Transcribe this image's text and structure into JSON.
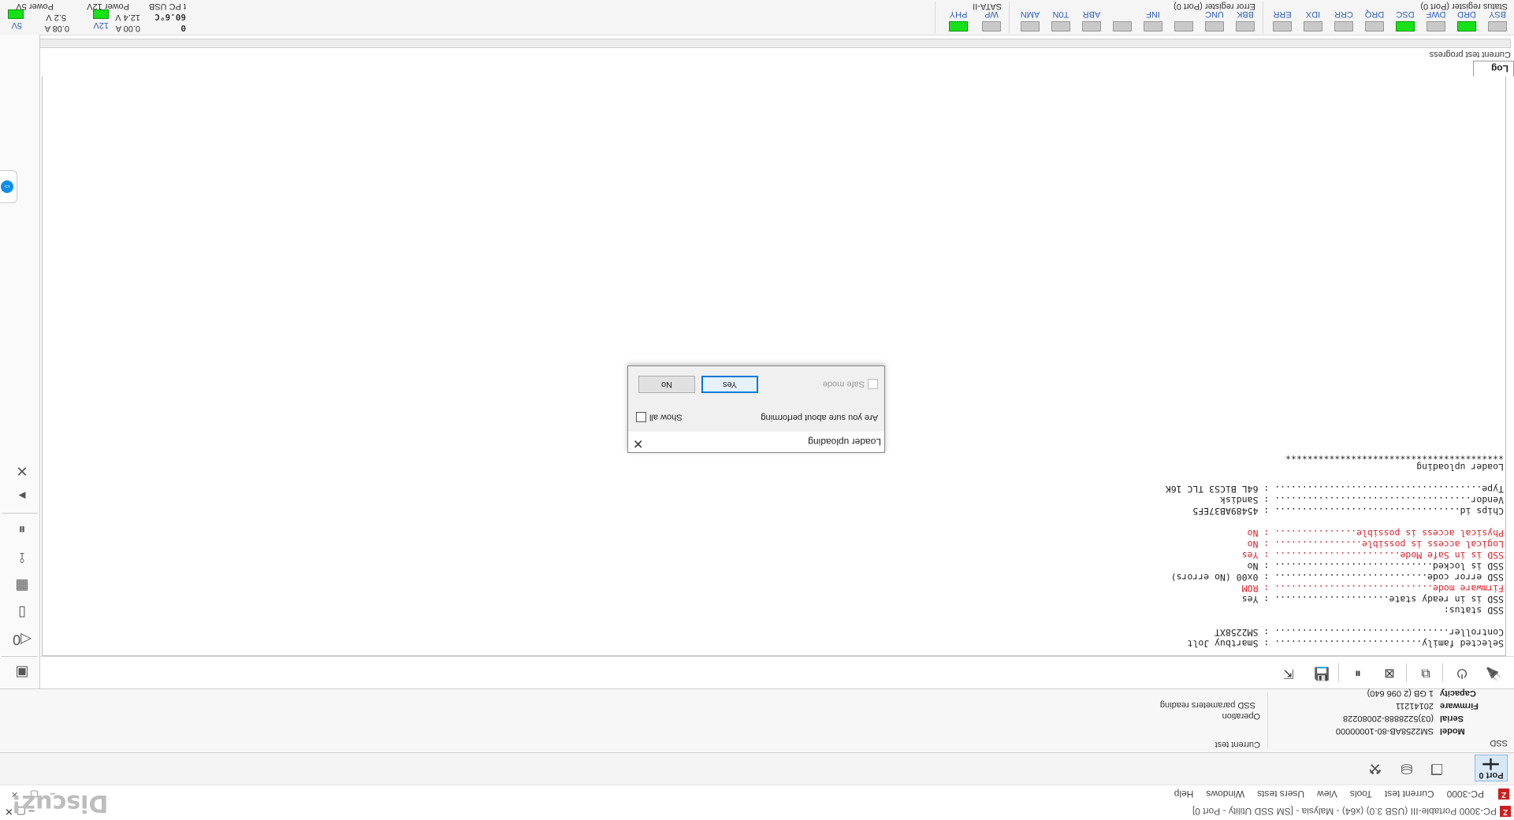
{
  "window": {
    "title": "PC-3000 Portable-III (USB 3.0) (x64) - Malysia - [SM SSD Utility - Port 0]",
    "controls": "–  ▢  ✕",
    "mdi_controls": "– ▢ ✕"
  },
  "menu": {
    "items": [
      "PC-3000",
      "Current test",
      "Tools",
      "View",
      "Users tests",
      "Windows",
      "Help"
    ]
  },
  "watermark": "Discuz!",
  "toolbar2": {
    "port_label": "Port 0"
  },
  "ssd": {
    "caption": "SSD",
    "rows": [
      {
        "key": "Model",
        "value": "SM2258AB-80-10000000"
      },
      {
        "key": "Serial",
        "value": "(03)5228888-20080228"
      },
      {
        "key": "Firmware",
        "value": "20141211"
      },
      {
        "key": "Capacity",
        "value": "1 GB (2 096 640)"
      }
    ]
  },
  "test": {
    "current_test_caption": "Current test",
    "operation_caption": "Operation",
    "operation_value": "SSD parameters reading"
  },
  "log": {
    "tab": "Log",
    "lines": [
      {
        "text": "Selected family........................... : Smartbuy Jolt",
        "red": false
      },
      {
        "text": "Controller................................ : SM2258XT",
        "red": false
      },
      {
        "text": "",
        "red": false
      },
      {
        "text": "SSD status:",
        "red": false
      },
      {
        "text": "SSD is in ready state..................... : Yes",
        "red": false
      },
      {
        "text": "Firmware mode............................. : ROM",
        "red": true
      },
      {
        "text": "SSD error code............................ : 0x00 (No errors)",
        "red": false
      },
      {
        "text": "SSD is locked............................. : No",
        "red": false
      },
      {
        "text": "SSD is in Safe Mode....................... : Yes",
        "red": true
      },
      {
        "text": "Logical access is possible................ : No",
        "red": true
      },
      {
        "text": "Physical access is possible............... : No",
        "red": true
      },
      {
        "text": "",
        "red": false
      },
      {
        "text": "Chips id.................................. : 45489AB37EF5",
        "red": false
      },
      {
        "text": "Vendor.................................... : Sandisk",
        "red": false
      },
      {
        "text": "Type...................................... : 64L BiCS3 TLC 16K",
        "red": false
      },
      {
        "text": "",
        "red": false
      },
      {
        "text": "Loader uploading",
        "red": false
      },
      {
        "text": "****************************************",
        "red": false
      }
    ]
  },
  "progress": {
    "caption": "Current test progress",
    "value": 0
  },
  "status_register": {
    "title": "Status register (Port 0)",
    "bits": [
      {
        "label": "BSY",
        "on": false
      },
      {
        "label": "DRD",
        "on": true
      },
      {
        "label": "DWF",
        "on": false
      },
      {
        "label": "DSC",
        "on": true
      },
      {
        "label": "DRQ",
        "on": false
      },
      {
        "label": "CRR",
        "on": false
      },
      {
        "label": "IDX",
        "on": false
      },
      {
        "label": "ERR",
        "on": false
      }
    ]
  },
  "error_register": {
    "title": "Error register (Port 0)",
    "bits": [
      {
        "label": "BBK",
        "on": false
      },
      {
        "label": "UNC",
        "on": false
      },
      {
        "label": "",
        "on": false
      },
      {
        "label": "INF",
        "on": false
      },
      {
        "label": "",
        "on": false
      },
      {
        "label": "ABR",
        "on": false
      },
      {
        "label": "T0N",
        "on": false
      },
      {
        "label": "AMN",
        "on": false
      }
    ]
  },
  "sata": {
    "title": "SATA-II",
    "bits": [
      {
        "label": "WP",
        "on": false
      },
      {
        "label": "PHY",
        "on": true
      }
    ]
  },
  "power": {
    "p5v_caption": "Power 5V",
    "p5v_label": "5V",
    "p5v_voltage": "5.2 V",
    "p5v_current": "0.08 A",
    "p12v_caption": "Power 12V",
    "p12v_label": "12V",
    "p12v_voltage": "12.4 V",
    "p12v_current": "0.00 A",
    "usb_caption": "t PC USB",
    "temp": "60.6°C",
    "count": "0"
  },
  "dialog": {
    "title": "Loader uploading",
    "message": "Are you sure about performing",
    "show_all": "Show all",
    "yes": "Yes",
    "no": "No",
    "safe_mode": "Safe mode"
  }
}
